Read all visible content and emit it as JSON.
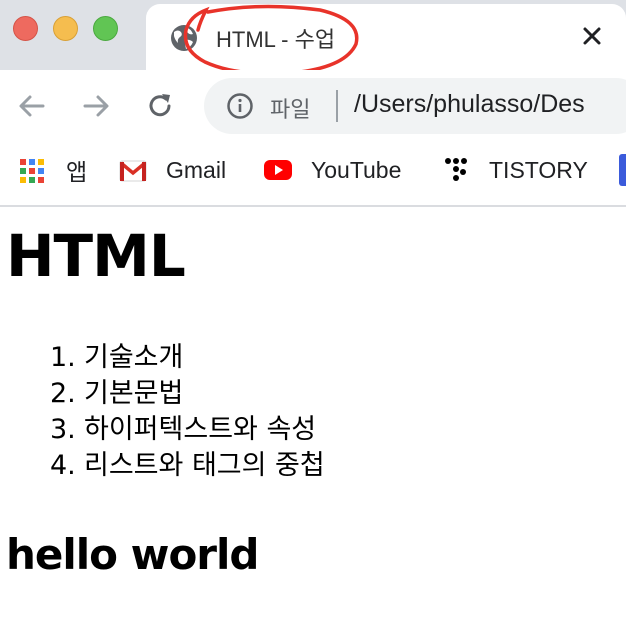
{
  "window": {
    "traffic_lights": [
      "close",
      "minimize",
      "maximize"
    ]
  },
  "tab": {
    "title": "HTML - 수업",
    "icon": "globe-icon",
    "close_icon": "close-icon",
    "annotation_color": "#e8332a"
  },
  "toolbar": {
    "back_icon": "arrow-left-icon",
    "forward_icon": "arrow-right-icon",
    "reload_icon": "reload-icon",
    "info_icon": "info-icon",
    "scheme_label": "파일",
    "url": "/Users/phulasso/Des"
  },
  "bookmarks": [
    {
      "label": "앱",
      "icon": "apps-grid-icon"
    },
    {
      "label": "Gmail",
      "icon": "gmail-icon"
    },
    {
      "label": "YouTube",
      "icon": "youtube-icon"
    },
    {
      "label": "TISTORY",
      "icon": "tistory-icon"
    }
  ],
  "page": {
    "title": "HTML",
    "topics": [
      {
        "num": "1.",
        "text": "기술소개"
      },
      {
        "num": "2.",
        "text": "기본문법"
      },
      {
        "num": "3.",
        "text": "하이퍼텍스트와 속성"
      },
      {
        "num": "4.",
        "text": "리스트와 태그의 중첩"
      }
    ],
    "subtitle": "hello world"
  }
}
